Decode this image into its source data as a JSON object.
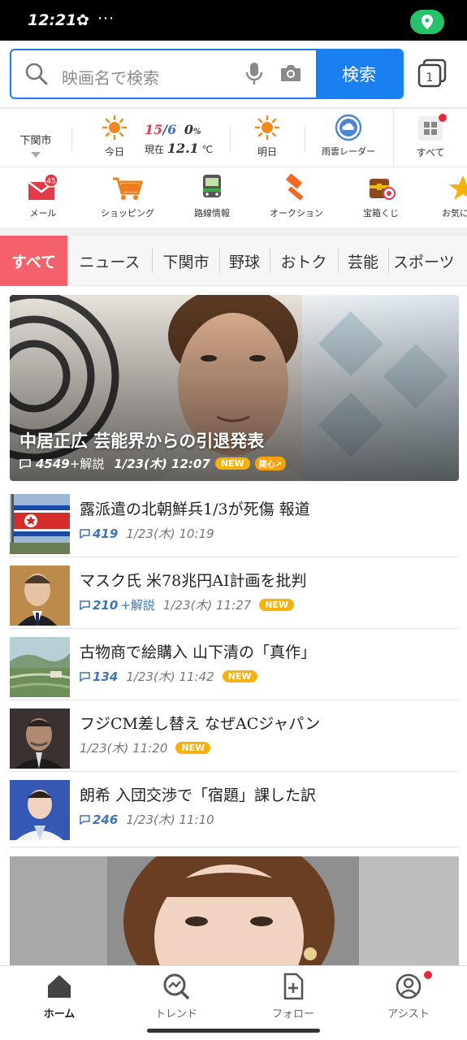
{
  "status_bar": {
    "time": "12:21",
    "pinwheel_icon": "✿",
    "more": "···"
  },
  "search": {
    "placeholder": "映画名で検索",
    "button_label": "検索"
  },
  "weather": {
    "location": "下関市",
    "today_label": "今日",
    "temp_high": "15",
    "temp_low": "6",
    "precip": "0",
    "precip_unit": "%",
    "current_label": "現在",
    "current_temp": "12.1",
    "current_unit": "℃",
    "tomorrow_label": "明日",
    "radar_label": "雨雲レーダー",
    "all_label": "すべて"
  },
  "services": [
    {
      "label": "メール",
      "badge": "45"
    },
    {
      "label": "ショッピング"
    },
    {
      "label": "路線情報"
    },
    {
      "label": "オークション"
    },
    {
      "label": "宝箱くじ"
    },
    {
      "label": "お気に"
    }
  ],
  "categories": [
    "すべて",
    "ニュース",
    "下関市",
    "野球",
    "おトク",
    "芸能",
    "スポーツ"
  ],
  "hero": {
    "title": "中居正広 芸能界からの引退発表",
    "comments": "4549",
    "comments_suffix": "+解説",
    "datetime": "1/23(木) 12:07",
    "badge_new": "NEW",
    "badge_interest": "関心↗"
  },
  "news": [
    {
      "title": "露派遣の北朝鮮兵1/3が死傷 報道",
      "comments": "419",
      "suffix": "",
      "datetime": "1/23(木) 10:19",
      "new": ""
    },
    {
      "title": "マスク氏 米78兆円AI計画を批判",
      "comments": "210",
      "suffix": "+解説",
      "datetime": "1/23(木) 11:27",
      "new": "NEW"
    },
    {
      "title": "古物商で絵購入 山下清の「真作」",
      "comments": "134",
      "suffix": "",
      "datetime": "1/23(木) 11:42",
      "new": "NEW"
    },
    {
      "title": "フジCM差し替え なぜACジャパン",
      "comments": "",
      "suffix": "",
      "datetime": "1/23(木) 11:20",
      "new": "NEW"
    },
    {
      "title": "朗希 入団交渉で「宿題」課した訳",
      "comments": "246",
      "suffix": "",
      "datetime": "1/23(木) 11:10",
      "new": ""
    }
  ],
  "bottom_nav": [
    "ホーム",
    "トレンド",
    "フォロー",
    "アシスト"
  ],
  "colors": {
    "accent_blue": "#1a7ff0",
    "tab_active": "#f4606b",
    "new_badge": "#f6b10a"
  }
}
